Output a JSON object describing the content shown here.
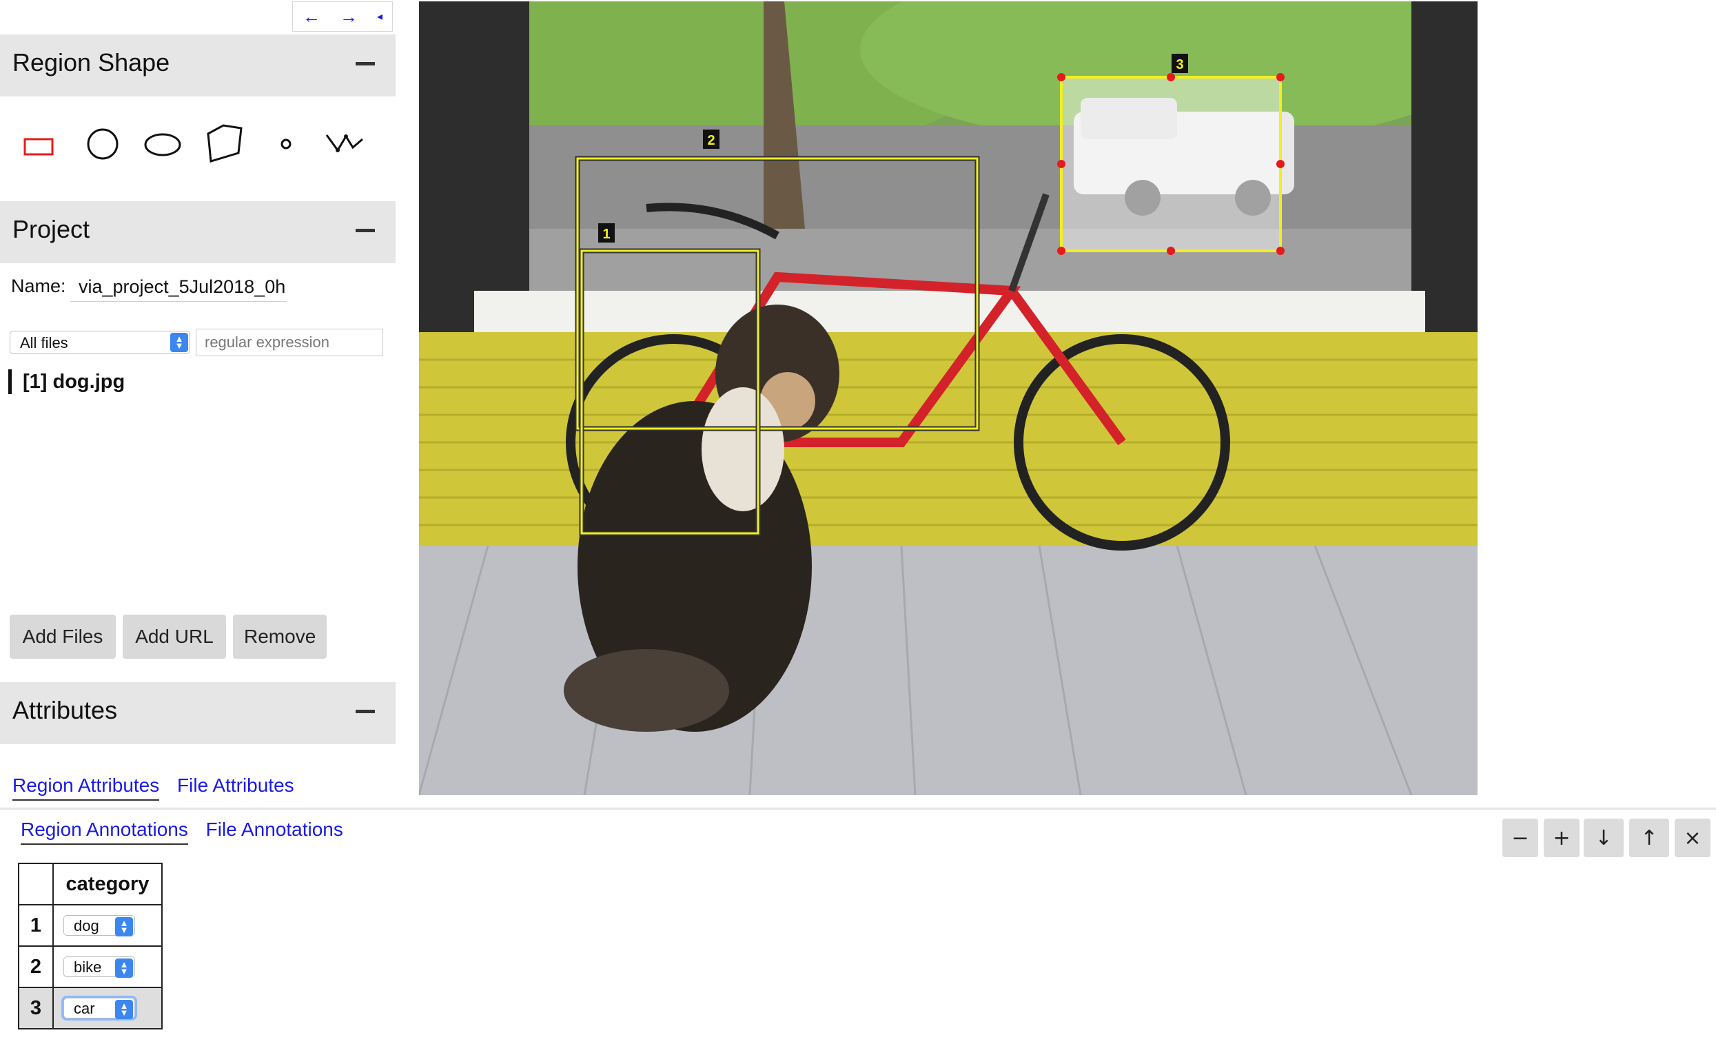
{
  "nav": {
    "prev": "←",
    "next": "→",
    "collapse": "◂"
  },
  "region_shape": {
    "title": "Region Shape",
    "collapse": "—",
    "shapes": [
      "rectangle-icon",
      "circle-icon",
      "ellipse-icon",
      "polygon-icon",
      "point-icon",
      "polyline-icon"
    ],
    "selected_color": "#e31c1c"
  },
  "project": {
    "title": "Project",
    "name_label": "Name:",
    "name_value": "via_project_5Jul2018_0h",
    "filter_value": "All files",
    "regex_placeholder": "regular expression",
    "files": [
      {
        "label": "[1] dog.jpg"
      }
    ],
    "buttons": {
      "add_files": "Add Files",
      "add_url": "Add URL",
      "remove": "Remove"
    }
  },
  "attributes": {
    "title": "Attributes",
    "tabs": [
      "Region Attributes",
      "File Attributes"
    ]
  },
  "canvas": {
    "regions": [
      {
        "id": "1",
        "label": "dog"
      },
      {
        "id": "2",
        "label": "bike"
      },
      {
        "id": "3",
        "label": "car"
      }
    ],
    "box_color": "#f3ef1e",
    "handle_color": "#e6191c"
  },
  "annotations": {
    "tabs": [
      "Region Annotations",
      "File Annotations"
    ],
    "tools": [
      "−",
      "+",
      "↓",
      "↑",
      "×"
    ],
    "header": "category",
    "rows": [
      {
        "index": "1",
        "value": "dog"
      },
      {
        "index": "2",
        "value": "bike"
      },
      {
        "index": "3",
        "value": "car"
      }
    ]
  }
}
